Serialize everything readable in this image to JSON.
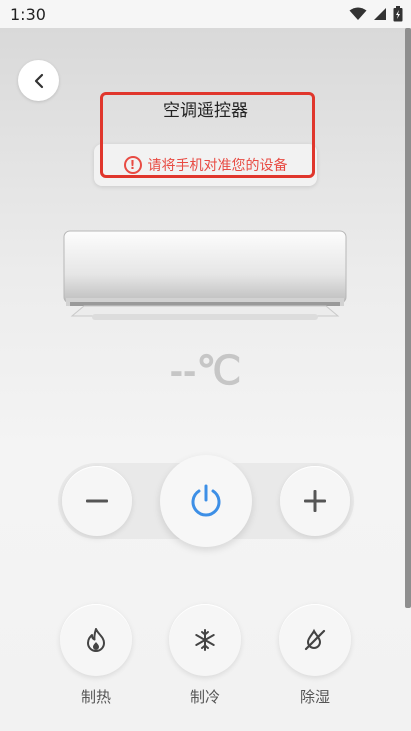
{
  "status_bar": {
    "time": "1:30",
    "icons": [
      "wifi-icon",
      "cellular-signal-icon",
      "battery-icon"
    ]
  },
  "header": {
    "title": "空调遥控器",
    "back_icon": "chevron-left-icon"
  },
  "hint": {
    "text": "请将手机对准您的设备",
    "icon": "warning-circle-icon",
    "color": "#e84b43"
  },
  "display": {
    "temperature": "--℃"
  },
  "controls": {
    "decrease_icon": "minus-icon",
    "power_icon": "power-icon",
    "increase_icon": "plus-icon",
    "power_color": "#3d8fe6"
  },
  "modes": [
    {
      "label": "制热",
      "icon": "flame-icon"
    },
    {
      "label": "制冷",
      "icon": "snowflake-icon"
    },
    {
      "label": "除湿",
      "icon": "dehumidify-icon"
    }
  ]
}
